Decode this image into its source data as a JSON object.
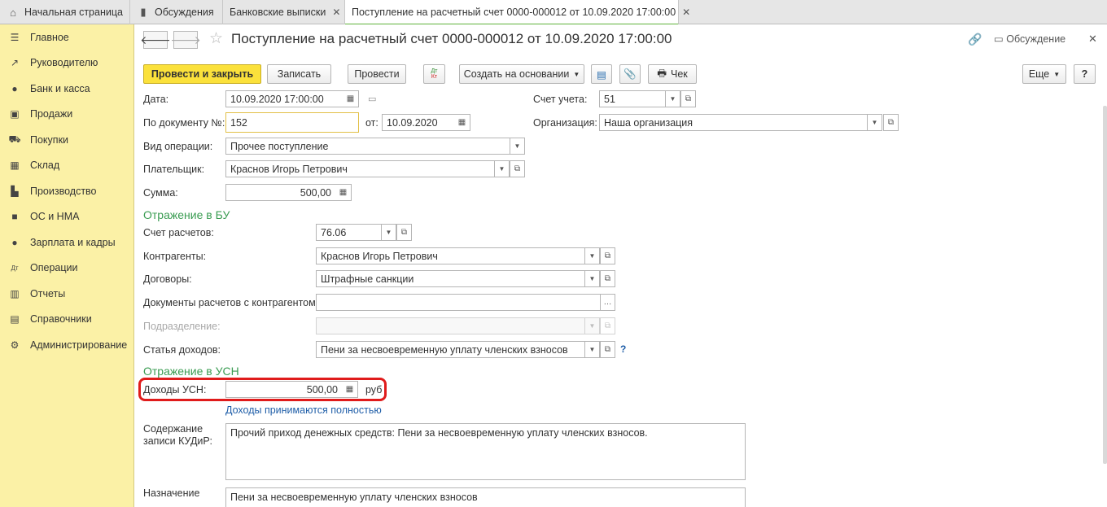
{
  "tabs": [
    {
      "label": "Начальная страница",
      "icon": "home-icon",
      "close": false
    },
    {
      "label": "Обсуждения",
      "icon": "discussion-icon",
      "close": false
    },
    {
      "label": "Банковские выписки",
      "icon": "",
      "close": true
    },
    {
      "label": "Поступление на расчетный счет 0000-000012 от 10.09.2020 17:00:00",
      "icon": "",
      "close": true
    }
  ],
  "sidebar": {
    "items": [
      {
        "label": "Главное",
        "icon": "menu-icon"
      },
      {
        "label": "Руководителю",
        "icon": "trend-icon"
      },
      {
        "label": "Банк и касса",
        "icon": "ruble-icon"
      },
      {
        "label": "Продажи",
        "icon": "bag-icon"
      },
      {
        "label": "Покупки",
        "icon": "cart-icon"
      },
      {
        "label": "Склад",
        "icon": "warehouse-icon"
      },
      {
        "label": "Производство",
        "icon": "factory-icon"
      },
      {
        "label": "ОС и НМА",
        "icon": "truck-icon"
      },
      {
        "label": "Зарплата и кадры",
        "icon": "person-icon"
      },
      {
        "label": "Операции",
        "icon": "dt-kt-icon"
      },
      {
        "label": "Отчеты",
        "icon": "bar-chart-icon"
      },
      {
        "label": "Справочники",
        "icon": "book-icon"
      },
      {
        "label": "Администрирование",
        "icon": "gear-icon"
      }
    ]
  },
  "header": {
    "title": "Поступление на расчетный счет 0000-000012 от 10.09.2020 17:00:00",
    "discussion_label": "Обсуждение"
  },
  "toolbar": {
    "post_close": "Провести и закрыть",
    "save": "Записать",
    "post": "Провести",
    "dt_kt": "Дт Кт",
    "create_based": "Создать на основании",
    "check": "Чек",
    "more": "Еще",
    "help": "?"
  },
  "form": {
    "date_label": "Дата:",
    "date_value": "10.09.2020 17:00:00",
    "account_label": "Счет учета:",
    "account_value": "51",
    "doc_label": "По документу №:",
    "doc_value": "152",
    "from_label": "от:",
    "from_value": "10.09.2020",
    "org_label": "Организация:",
    "org_value": "Наша организация",
    "op_label": "Вид операции:",
    "op_value": "Прочее поступление",
    "payer_label": "Плательщик:",
    "payer_value": "Краснов Игорь Петрович",
    "sum_label": "Сумма:",
    "sum_value": "500,00"
  },
  "bu": {
    "title": "Отражение в БУ",
    "settle_label": "Счет расчетов:",
    "settle_value": "76.06",
    "contr_label": "Контрагенты:",
    "contr_value": "Краснов Игорь Петрович",
    "contracts_label": "Договоры:",
    "contracts_value": "Штрафные санкции",
    "docs_label": "Документы расчетов с контрагентом:",
    "docs_value": "",
    "dept_label": "Подразделение:",
    "dept_value": "",
    "income_label": "Статья доходов:",
    "income_value": "Пени за несвоевременную уплату членских взносов"
  },
  "usn": {
    "title": "Отражение в УСН",
    "income_label": "Доходы УСН:",
    "income_value": "500,00",
    "currency": "руб",
    "link": "Доходы принимаются полностью",
    "kudir_label_1": "Содержание",
    "kudir_label_2": "записи КУДиР:",
    "kudir_value": "Прочий приход денежных средств: Пени за несвоевременную уплату членских взносов.",
    "purpose_label": "Назначение",
    "purpose_value": "Пени за несвоевременную уплату членских взносов"
  },
  "colors": {
    "accent_yellow": "#fbe13b",
    "sidebar_bg": "#fbf1a6",
    "section_green": "#3a9c52",
    "highlight_red": "#e01b1b",
    "link_blue": "#1f5ea8"
  }
}
